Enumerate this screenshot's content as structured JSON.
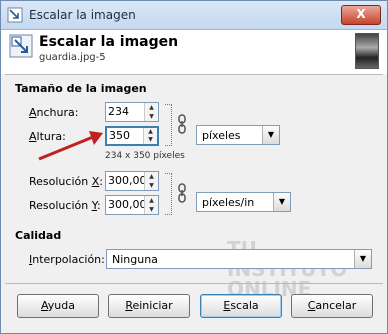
{
  "window": {
    "title": "Escalar la imagen",
    "close_label": "X"
  },
  "header": {
    "title": "Escalar la imagen",
    "subtitle": "guardia.jpg-5"
  },
  "image_size": {
    "section_title": "Tamaño de la imagen",
    "width_label_u": "A",
    "width_label_rest": "nchura:",
    "width_value": "234",
    "height_label_u": "A",
    "height_label_rest": "ltura:",
    "height_value": "350",
    "dimension_text": "234 x 350 píxeles",
    "unit_value": "píxeles",
    "res_x_label_a": "Resolución ",
    "res_x_label_u": "X",
    "res_x_label_b": ":",
    "res_x_value": "300,000",
    "res_y_label_a": "Resolución ",
    "res_y_label_u": "Y",
    "res_y_label_b": ":",
    "res_y_value": "300,000",
    "res_unit_value": "píxeles/in"
  },
  "quality": {
    "section_title": "Calidad",
    "interp_label_u": "I",
    "interp_label_rest": "nterpolación:",
    "interp_value": "Ninguna"
  },
  "watermark": {
    "line1": "TU",
    "line2": "INSTITUTO",
    "line3": "ONLINE"
  },
  "buttons": {
    "help_u": "A",
    "help_rest": "yuda",
    "reset_u": "R",
    "reset_rest": "einiciar",
    "scale_u": "E",
    "scale_rest": "scala",
    "cancel_u": "C",
    "cancel_rest": "ancelar"
  },
  "colors": {
    "arrow": "#c0211f",
    "focus": "#3c7fb1"
  }
}
